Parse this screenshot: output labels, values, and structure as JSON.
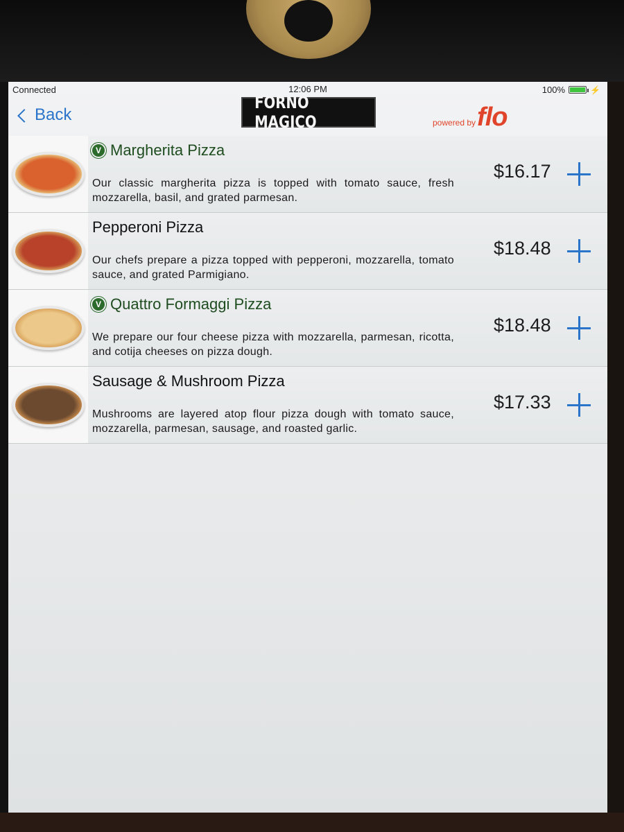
{
  "status_bar": {
    "network": "Connected",
    "time": "12:06 PM",
    "battery": "100%"
  },
  "nav": {
    "back_label": "Back",
    "logo_text": "FORNO MAGICO",
    "powered_by": "powered by",
    "powered_brand": "flo"
  },
  "menu": {
    "items": [
      {
        "name": "Margherita Pizza",
        "vegetarian": true,
        "description": "Our classic margherita pizza is topped with tomato sauce, fresh mozzarella, basil, and grated parmesan.",
        "price": "$16.17"
      },
      {
        "name": "Pepperoni Pizza",
        "vegetarian": false,
        "description": "Our chefs prepare a pizza topped with pepperoni, mozzarella, tomato sauce, and grated Parmigiano.",
        "price": "$18.48"
      },
      {
        "name": "Quattro Formaggi Pizza",
        "vegetarian": true,
        "description": "We prepare our four cheese pizza with mozzarella, parmesan, ricotta, and cotija cheeses on pizza dough.",
        "price": "$18.48"
      },
      {
        "name": "Sausage & Mushroom Pizza",
        "vegetarian": false,
        "description": "Mushrooms are layered atop flour pizza dough with tomato sauce, mozzarella, parmesan, sausage, and roasted garlic.",
        "price": "$17.33"
      }
    ]
  },
  "icons": {
    "veg_badge": "V",
    "add": "plus-icon"
  },
  "colors": {
    "accent": "#2a74c9",
    "veg": "#2d6b2d",
    "brand": "#e0442a"
  }
}
